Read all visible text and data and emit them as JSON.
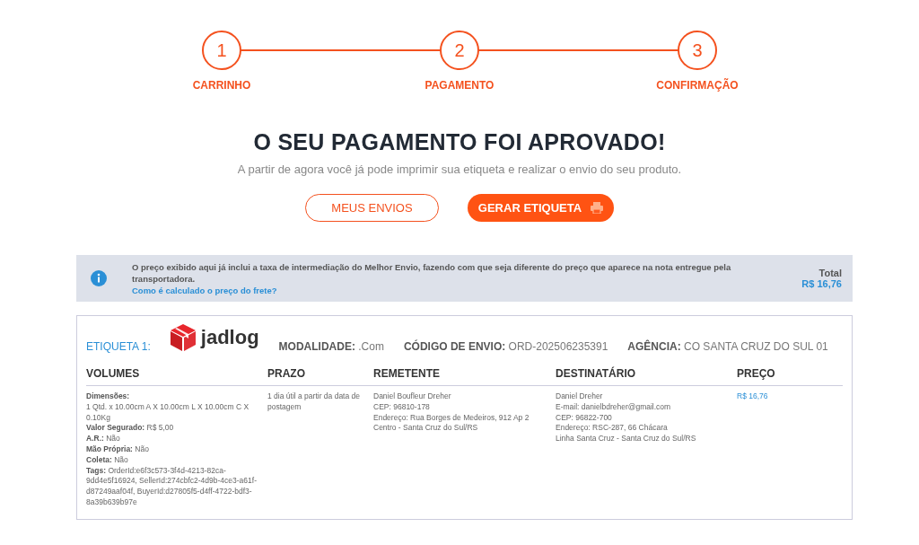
{
  "steps": [
    {
      "number": "1",
      "label": "CARRINHO"
    },
    {
      "number": "2",
      "label": "PAGAMENTO"
    },
    {
      "number": "3",
      "label": "CONFIRMAÇÃO"
    }
  ],
  "title": "O SEU PAGAMENTO FOI APROVADO!",
  "subtitle": "A partir de agora você já pode imprimir sua etiqueta e realizar o envio do seu produto.",
  "buttons": [
    {
      "label": "MEUS ENVIOS",
      "kind": "outline"
    },
    {
      "label": "GERAR ETIQUETA",
      "kind": "primary"
    }
  ],
  "notice": {
    "text": "O preço exibido aqui já inclui a taxa de intermediação do Melhor Envio, fazendo com que seja diferente do preço que aparece na nota entregue pela transportadora.",
    "link": "Como é calculado o preço do frete?",
    "total_label": "Total",
    "total_value": "R$ 16,76"
  },
  "label_card": {
    "title": "ETIQUETA 1:",
    "carrier": "jadlog",
    "fields": [
      "**MODALIDADE:** .Com",
      "**CÓDIGO DE ENVIO:** ORD-202506235391",
      "**AGÊNCIA:** CO SANTA CRUZ DO SUL 01"
    ],
    "columns": [
      {
        "heading": "VOLUMES",
        "lines": [
          "**Dimensões:**",
          "1 Qtd. x 10.00cm A X 10.00cm L X 10.00cm C X 0.10Kg",
          "**Valor Segurado:** R$ 5,00",
          "**A.R.:** Não",
          "**Mão Própria:** Não",
          "**Coleta:** Não",
          "**Tags:** OrderId:e6f3c573-3f4d-4213-82ca-9dd4e5f16924, SellerId:274cbfc2-4d9b-4ce3-a61f-d87249aaf04f, BuyerId:d27805f5-d4ff-4722-bdf3-8a39b639b97e"
        ]
      },
      {
        "heading": "PRAZO",
        "lines": [
          "1 dia útil a partir da data de postagem"
        ]
      },
      {
        "heading": "REMETENTE",
        "lines": [
          "Daniel Boufleur Dreher",
          "CEP: 96810-178",
          "Endereço: Rua Borges de Medeiros, 912 Ap 2",
          "Centro - Santa Cruz do Sul/RS"
        ]
      },
      {
        "heading": "DESTINATÁRIO",
        "lines": [
          "Daniel Dreher",
          "E-mail: danielbdreher@gmail.com",
          "CEP: 96822-700",
          "Endereço: RSC-287, 66 Chácara",
          "Linha Santa Cruz - Santa Cruz do Sul/RS"
        ]
      },
      {
        "heading": "PREÇO",
        "kind": "price",
        "lines": [
          "R$ 16,76"
        ]
      }
    ]
  }
}
